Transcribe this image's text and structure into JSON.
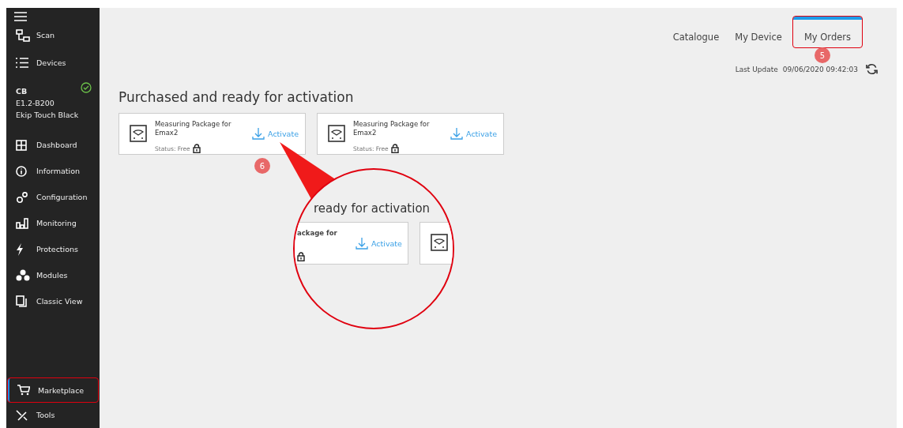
{
  "sidebar": {
    "items": [
      {
        "kind": "menu"
      },
      {
        "kind": "nav",
        "label": "Scan",
        "selected": false
      },
      {
        "kind": "nav",
        "label": "Devices",
        "selected": false
      },
      {
        "kind": "device",
        "name": "CB",
        "model": "E1.2-B200",
        "type": "Ekip Touch Black",
        "connected": true
      },
      {
        "kind": "nav",
        "label": "Dashboard",
        "selected": false
      },
      {
        "kind": "nav",
        "label": "Information",
        "selected": false
      },
      {
        "kind": "nav",
        "label": "Configuration",
        "selected": false
      },
      {
        "kind": "nav",
        "label": "Monitoring",
        "selected": false
      },
      {
        "kind": "nav",
        "label": "Protections",
        "selected": false
      },
      {
        "kind": "nav",
        "label": "Modules",
        "selected": false
      },
      {
        "kind": "nav",
        "label": "Classic View",
        "selected": false
      },
      {
        "kind": "spacer"
      },
      {
        "kind": "nav",
        "label": "Marketplace",
        "selected": true,
        "highlighted": true
      },
      {
        "kind": "nav",
        "label": "Tools",
        "selected": false
      }
    ]
  },
  "tabs": [
    {
      "label": "Catalogue",
      "selected": false,
      "highlighted": false
    },
    {
      "label": "My Device",
      "selected": false,
      "highlighted": false
    },
    {
      "label": "My Orders",
      "selected": true,
      "highlighted": true,
      "callout": "5"
    }
  ],
  "last_update": {
    "label": "Last Update",
    "value": "09/06/2020 09:42:03"
  },
  "section_title": "Purchased and ready for activation",
  "cards": [
    {
      "title": "Measuring Package for Emax2",
      "status": "Status: Free",
      "action": "Activate",
      "callout": "6"
    },
    {
      "title": "Measuring Package for Emax2",
      "status": "Status: Free",
      "action": "Activate"
    }
  ],
  "magnifier": {
    "title": "ready for activation",
    "card_title": "ackage for",
    "action": "Activate"
  }
}
